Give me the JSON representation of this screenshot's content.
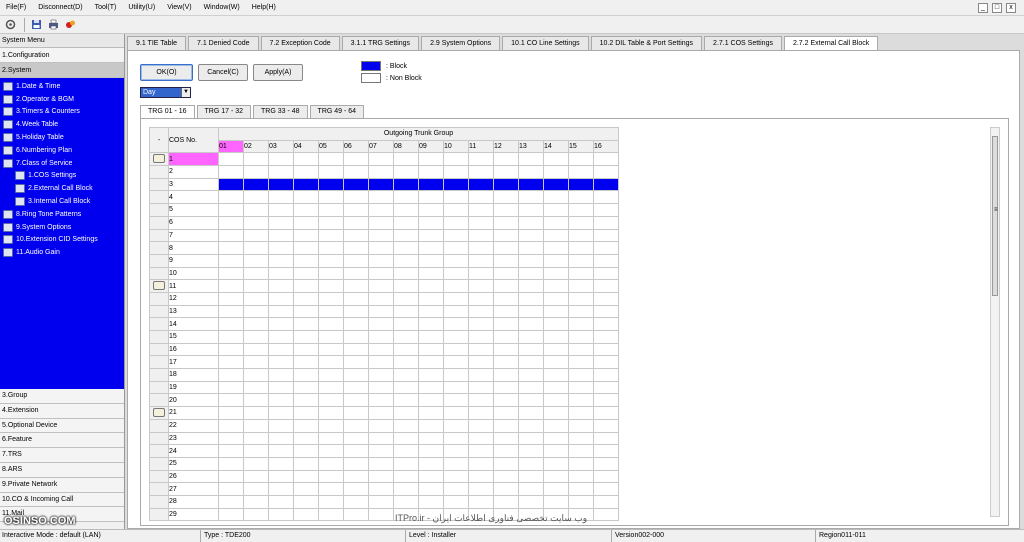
{
  "menu": [
    "File(F)",
    "Disconnect(D)",
    "Tool(T)",
    "Utility(U)",
    "View(V)",
    "Window(W)",
    "Help(H)"
  ],
  "window_controls": [
    "_",
    "□",
    "x"
  ],
  "toolbar_icons": [
    "settings-icon",
    "save-icon",
    "print-icon",
    "link-icon"
  ],
  "sidebar": {
    "title": "System Menu",
    "top_items": [
      "1.Configuration",
      "2.System"
    ],
    "tree": [
      {
        "label": "1.Date & Time",
        "level": 0
      },
      {
        "label": "2.Operator & BGM",
        "level": 0
      },
      {
        "label": "3.Timers & Counters",
        "level": 0
      },
      {
        "label": "4.Week Table",
        "level": 0
      },
      {
        "label": "5.Holiday Table",
        "level": 0
      },
      {
        "label": "6.Numbering Plan",
        "level": 0
      },
      {
        "label": "7.Class of Service",
        "level": 0
      },
      {
        "label": "1.COS Settings",
        "level": 1
      },
      {
        "label": "2.External Call Block",
        "level": 1
      },
      {
        "label": "3.Internal Call Block",
        "level": 1
      },
      {
        "label": "8.Ring Tone Patterns",
        "level": 0
      },
      {
        "label": "9.System Options",
        "level": 0
      },
      {
        "label": "10.Extension CID Settings",
        "level": 0
      },
      {
        "label": "11.Audio Gain",
        "level": 0
      }
    ],
    "bottom_items": [
      "3.Group",
      "4.Extension",
      "5.Optional Device",
      "6.Feature",
      "7.TRS",
      "8.ARS",
      "9.Private Network",
      "10.CO & Incoming Call",
      "11.Mail"
    ]
  },
  "tabs": [
    "9.1 TIE Table",
    "7.1 Denied Code",
    "7.2 Exception Code",
    "3.1.1 TRG Settings",
    "2.9 System Options",
    "10.1 CO Line Settings",
    "10.2 DIL Table & Port Settings",
    "2.7.1 COS Settings",
    "2.7.2 External Call Block"
  ],
  "active_tab": 8,
  "buttons": {
    "ok": "OK(O)",
    "cancel": "Cancel(C)",
    "apply": "Apply(A)"
  },
  "legend": {
    "block": ": Block",
    "non_block": ": Non Block",
    "block_color": "#0000ee",
    "non_block_color": "#ffffff"
  },
  "day_select": "Day",
  "subtabs": [
    "TRG 01 - 16",
    "TRG 17 - 32",
    "TRG 33 - 48",
    "TRG 49 - 64"
  ],
  "active_subtab": 0,
  "grid": {
    "corner": "-",
    "cos_header": "COS No.",
    "group_header": "Outgoing Trunk Group",
    "columns": [
      "01",
      "02",
      "03",
      "04",
      "05",
      "06",
      "07",
      "08",
      "09",
      "10",
      "11",
      "12",
      "13",
      "14",
      "15",
      "16"
    ],
    "rows": [
      "1",
      "2",
      "3",
      "4",
      "5",
      "6",
      "7",
      "8",
      "9",
      "10",
      "11",
      "12",
      "13",
      "14",
      "15",
      "16",
      "17",
      "18",
      "19",
      "20",
      "21",
      "22",
      "23",
      "24",
      "25",
      "26",
      "27",
      "28",
      "29"
    ],
    "blocked_rows": [
      "3"
    ],
    "selected_row": "1",
    "selected_column": "01",
    "hand_rows": [
      "1",
      "11",
      "21"
    ]
  },
  "status": {
    "mode": "Interactive Mode : default (LAN)",
    "type": "Type : TDE200",
    "level": "Level : Installer",
    "version": "Version002-000",
    "region": "Region011-011"
  },
  "watermark_left": "OSINSO.COM",
  "watermark_right": "ITPro.ir - وب سایت تخصصی فناوری اطلاعات ایران"
}
